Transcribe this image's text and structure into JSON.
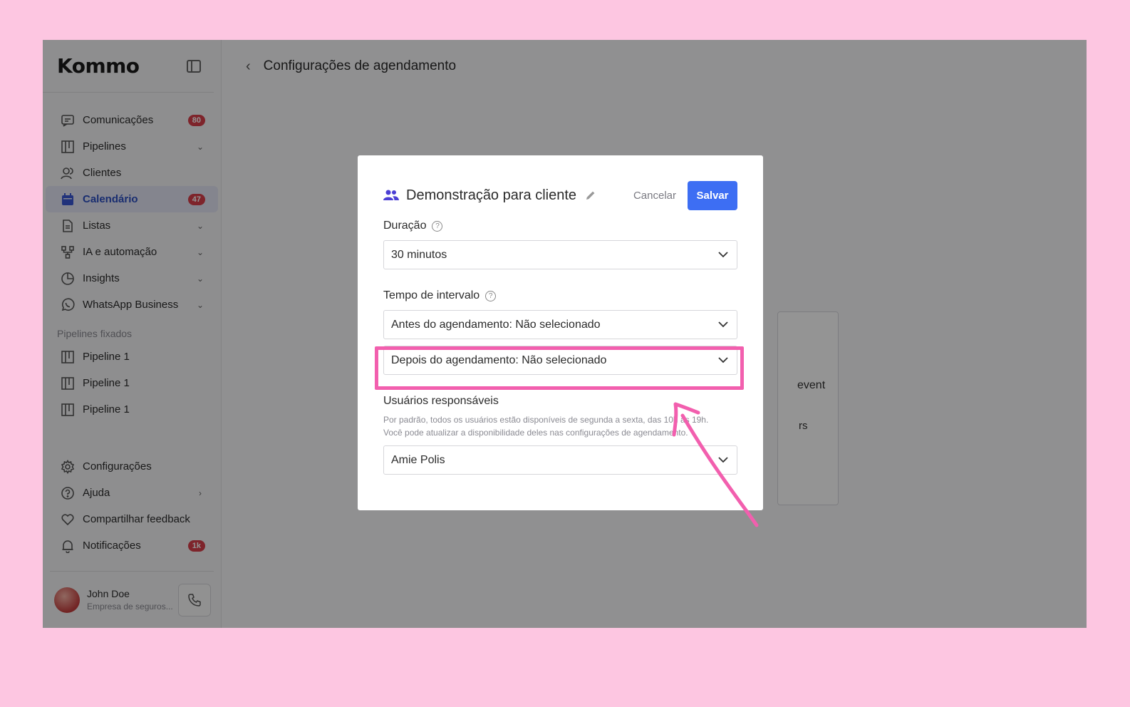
{
  "app": {
    "logo": "Kommo",
    "page_title": "Configurações de agendamento"
  },
  "sidebar": {
    "items": [
      {
        "label": "Comunicações",
        "badge": "80"
      },
      {
        "label": "Pipelines"
      },
      {
        "label": "Clientes"
      },
      {
        "label": "Calendário",
        "badge": "47"
      },
      {
        "label": "Listas"
      },
      {
        "label": "IA e automação"
      },
      {
        "label": "Insights"
      },
      {
        "label": "WhatsApp Business"
      }
    ],
    "section_label": "Pipelines fixados",
    "pinned": [
      {
        "label": "Pipeline 1"
      },
      {
        "label": "Pipeline 1"
      },
      {
        "label": "Pipeline 1"
      }
    ],
    "bottom": [
      {
        "label": "Configurações"
      },
      {
        "label": "Ajuda"
      },
      {
        "label": "Compartilhar feedback"
      },
      {
        "label": "Notificações",
        "badge": "1k"
      }
    ],
    "user": {
      "name": "John Doe",
      "company": "Empresa de seguros..."
    }
  },
  "background": {
    "text1": "event",
    "text2": "rs"
  },
  "modal": {
    "title": "Demonstração para cliente",
    "cancel_label": "Cancelar",
    "save_label": "Salvar",
    "duration_label": "Duração",
    "duration_value": "30 minutos",
    "interval_label": "Tempo de intervalo",
    "before_value": "Antes do agendamento: Não selecionado",
    "after_value": "Depois do agendamento: Não selecionado",
    "users_label": "Usuários responsáveis",
    "users_help_1": "Por padrão, todos os usuários estão disponíveis de segunda a sexta, das 10h às 19h.",
    "users_help_2": "Você pode atualizar a disponibilidade deles nas configurações de agendamento.",
    "users_value": "Amie Polis"
  },
  "colors": {
    "primary": "#3d6ef3",
    "highlight": "#f25fae",
    "background": "#fdc6e1",
    "badge": "#d93f4a"
  }
}
